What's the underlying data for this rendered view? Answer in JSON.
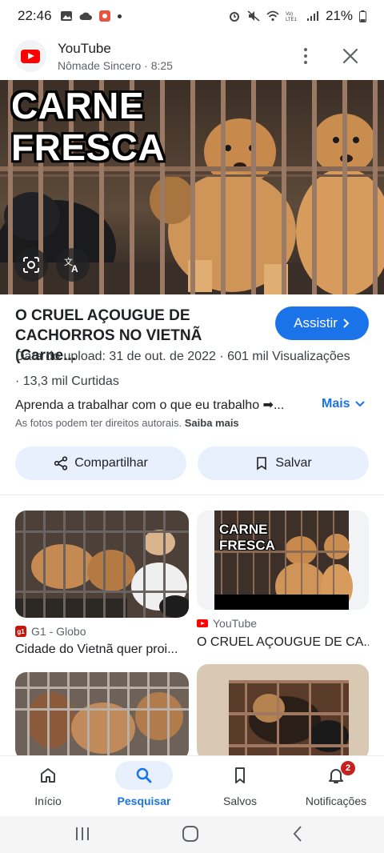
{
  "status_bar": {
    "time": "22:46",
    "battery": "21%"
  },
  "header": {
    "source": "YouTube",
    "subtitle": "Nômade Sincero · 8:25"
  },
  "hero": {
    "overlay_text_line1": "CARNE",
    "overlay_text_line2": "FRESCA"
  },
  "video": {
    "title": "O CRUEL AÇOUGUE DE CACHORROS NO VIETNÃ (Carne...",
    "watch_label": "Assistir",
    "meta_line1": "Data do upload: 31 de out. de 2022  ·  601 mil Visualizações",
    "meta_line2": "·  13,3 mil Curtidas",
    "description": "Aprenda a trabalhar com o que eu trabalho ➡...",
    "more_label": "Mais",
    "copyright_text": "As fotos podem ter direitos autorais.",
    "learn_more": "Saiba mais"
  },
  "actions": {
    "share_label": "Compartilhar",
    "save_label": "Salvar"
  },
  "related": [
    {
      "source": "G1 - Globo",
      "title": "Cidade do Vietnã quer proi..."
    },
    {
      "source": "YouTube",
      "title": "O CRUEL AÇOUGUE DE CA...",
      "thumb_text_line1": "CARNE",
      "thumb_text_line2": "FRESCA"
    }
  ],
  "bottom_nav": {
    "items": [
      {
        "label": "Início",
        "icon": "home-icon"
      },
      {
        "label": "Pesquisar",
        "icon": "search-icon",
        "active": true
      },
      {
        "label": "Salvos",
        "icon": "bookmarks-icon"
      },
      {
        "label": "Notificações",
        "icon": "bell-icon",
        "badge": "2"
      }
    ]
  },
  "colors": {
    "accent": "#1a73e8",
    "pill_bg": "#e8f0fe",
    "badge": "#c5221f"
  }
}
